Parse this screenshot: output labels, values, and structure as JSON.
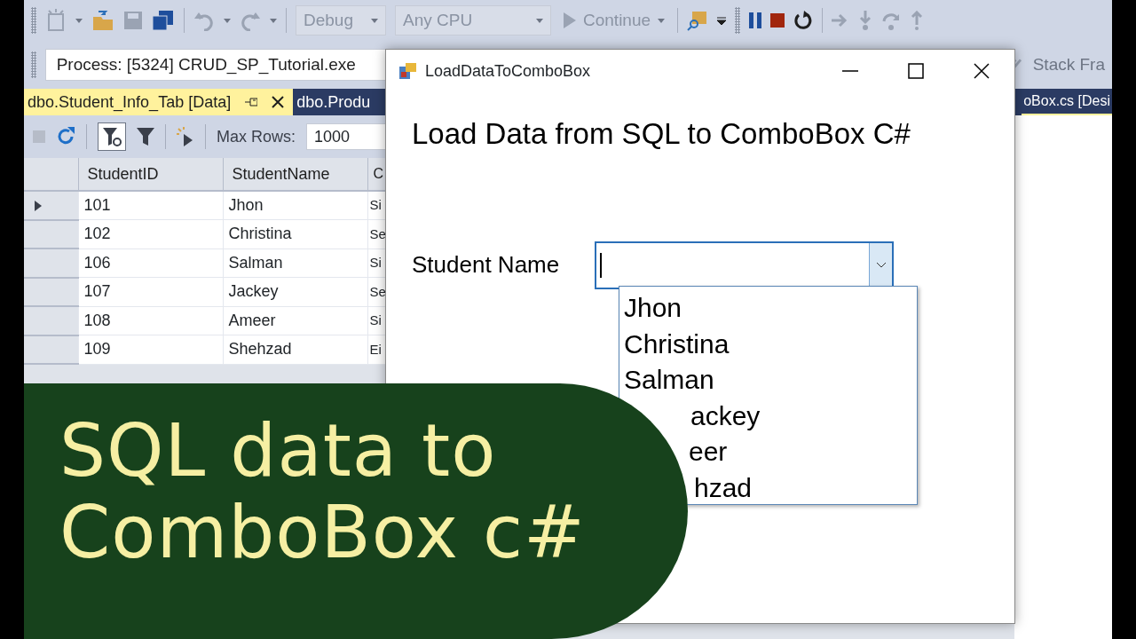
{
  "toolbar": {
    "configuration": "Debug",
    "platform": "Any CPU",
    "continue": "Continue"
  },
  "process_bar": {
    "process": "Process: [5324] CRUD_SP_Tutorial.exe",
    "stack_frame": "Stack Fra"
  },
  "document_tabs": [
    {
      "label": "dbo.Student_Info_Tab [Data]",
      "selected": true
    },
    {
      "label": "dbo.Produ",
      "selected": false
    }
  ],
  "right_tab": {
    "label": "oBox.cs [Desi",
    "selected": false
  },
  "data_toolbar": {
    "max_rows_label": "Max Rows:",
    "max_rows": "1000"
  },
  "grid": {
    "columns": [
      "StudentID",
      "StudentName",
      "C"
    ],
    "rows": [
      {
        "cells": [
          "101",
          "Jhon",
          "Si"
        ],
        "current": true
      },
      {
        "cells": [
          "102",
          "Christina",
          "Se"
        ],
        "current": false
      },
      {
        "cells": [
          "106",
          "Salman",
          "Si"
        ],
        "current": false
      },
      {
        "cells": [
          "107",
          "Jackey",
          "Se"
        ],
        "current": false
      },
      {
        "cells": [
          "108",
          "Ameer",
          "Si"
        ],
        "current": false
      },
      {
        "cells": [
          "109",
          "Shehzad",
          "Ei"
        ],
        "current": false
      }
    ]
  },
  "dialog": {
    "title": "LoadDataToComboBox",
    "heading": "Load Data from SQL to ComboBox C#",
    "label": "Student Name",
    "combo": {
      "expanded": true,
      "items": [
        "Jhon",
        "Christina",
        "Salman",
        "ackey",
        "eer",
        "hzad"
      ]
    }
  },
  "banner": {
    "lines": [
      "SQL data to",
      "ComboBox c#"
    ]
  }
}
